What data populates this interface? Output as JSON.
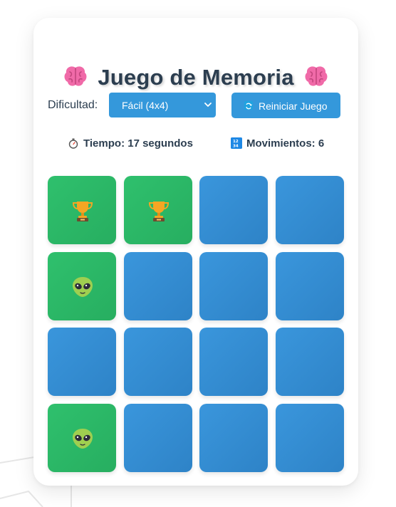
{
  "title": {
    "text": "Juego de Memoria",
    "left_icon": "brain-icon",
    "right_icon": "brain-icon"
  },
  "controls": {
    "difficulty_label": "Dificultad:",
    "difficulty_value": "Fácil (4x4)",
    "reset_label": "Reiniciar Juego",
    "reset_icon": "refresh-icon"
  },
  "stats": {
    "time_text": "Tiempo: 17 segundos",
    "time_icon": "stopwatch-icon",
    "moves_text": "Movimientos: 6",
    "moves_icon": "numbers-icon"
  },
  "board": {
    "rows": 4,
    "cols": 4,
    "tiles": [
      {
        "state": "shown",
        "icon": "trophy-icon"
      },
      {
        "state": "shown",
        "icon": "trophy-icon"
      },
      {
        "state": "hidden",
        "icon": ""
      },
      {
        "state": "hidden",
        "icon": ""
      },
      {
        "state": "shown",
        "icon": "alien-icon"
      },
      {
        "state": "hidden",
        "icon": ""
      },
      {
        "state": "hidden",
        "icon": ""
      },
      {
        "state": "hidden",
        "icon": ""
      },
      {
        "state": "hidden",
        "icon": ""
      },
      {
        "state": "hidden",
        "icon": ""
      },
      {
        "state": "hidden",
        "icon": ""
      },
      {
        "state": "hidden",
        "icon": ""
      },
      {
        "state": "shown",
        "icon": "alien-icon"
      },
      {
        "state": "hidden",
        "icon": ""
      },
      {
        "state": "hidden",
        "icon": ""
      },
      {
        "state": "hidden",
        "icon": ""
      }
    ]
  },
  "colors": {
    "accent": "#3498db",
    "matched": "#2ecc71",
    "text": "#2c3e50"
  }
}
